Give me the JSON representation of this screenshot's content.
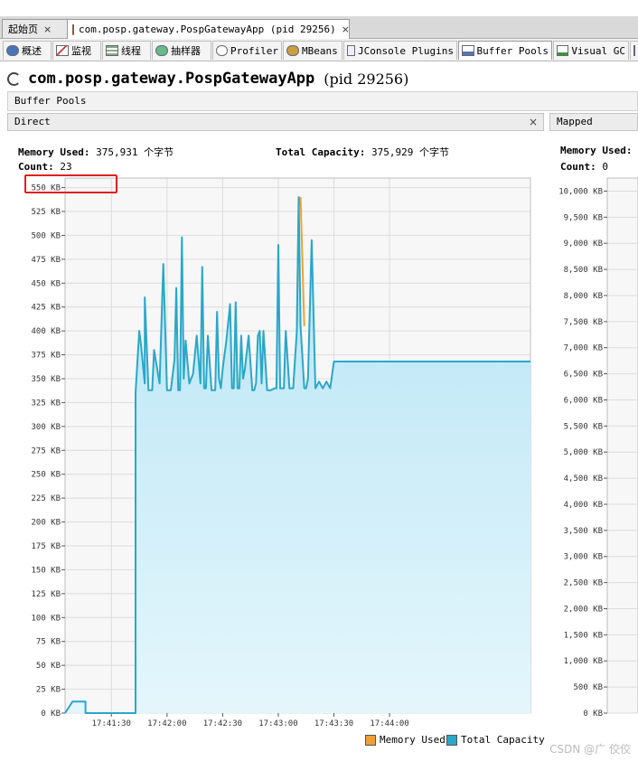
{
  "doc_tabs": [
    {
      "label": "起始页",
      "close": "×"
    },
    {
      "label": "com.posp.gateway.PospGatewayApp (pid 29256)",
      "close": "×"
    }
  ],
  "tool_tabs": [
    {
      "label": "概述",
      "icon": "info-icon"
    },
    {
      "label": "监视",
      "icon": "monitor-chart-icon"
    },
    {
      "label": "线程",
      "icon": "threads-icon"
    },
    {
      "label": "抽样器",
      "icon": "sampler-icon"
    },
    {
      "label": "Profiler",
      "icon": "profiler-clock-icon"
    },
    {
      "label": "MBeans",
      "icon": "mbeans-icon"
    },
    {
      "label": "JConsole Plugins",
      "icon": "jconsole-icon"
    },
    {
      "label": "Buffer Pools",
      "icon": "buffer-pools-icon"
    },
    {
      "label": "Visual GC",
      "icon": "visual-gc-icon"
    }
  ],
  "app": {
    "name": "com.posp.gateway.PospGatewayApp",
    "pid": "(pid 29256)"
  },
  "section_title": "Buffer Pools",
  "direct": {
    "title": "Direct",
    "close": "×",
    "memory_used_label": "Memory Used:",
    "memory_used_value": "375,931 个字节",
    "total_capacity_label": "Total Capacity:",
    "total_capacity_value": "375,929 个字节",
    "count_label": "Count:",
    "count_value": "23"
  },
  "mapped": {
    "title": "Mapped",
    "memory_used_label": "Memory Used:",
    "count_label": "Count:",
    "count_value": "0"
  },
  "legend": {
    "memory_used": "Memory Used",
    "total_capacity": "Total Capacity"
  },
  "colors": {
    "memory_used": "#f0a030",
    "total_capacity": "#2aa7c9",
    "fill": "#c8ecf8",
    "highlight": "#e02020"
  },
  "watermark": "CSDN @广 佼佼",
  "chart_data": [
    {
      "type": "area",
      "title": "Direct",
      "y_tick_labels": [
        "0 KB",
        "25 KB",
        "50 KB",
        "75 KB",
        "100 KB",
        "125 KB",
        "150 KB",
        "175 KB",
        "200 KB",
        "225 KB",
        "250 KB",
        "275 KB",
        "300 KB",
        "325 KB",
        "350 KB",
        "375 KB",
        "400 KB",
        "425 KB",
        "450 KB",
        "475 KB",
        "500 KB",
        "525 KB",
        "550 KB"
      ],
      "x_tick_labels": [
        "17:41:30",
        "17:42:00",
        "17:42:30",
        "17:43:00",
        "17:43:30",
        "17:44:00"
      ],
      "x_unit": "seconds after 17:41:00",
      "ylim": [
        0,
        560
      ],
      "xlim": [
        5,
        256
      ],
      "series": [
        {
          "name": "Total Capacity",
          "x": [
            5,
            9,
            16,
            16,
            43,
            43,
            45,
            46,
            48,
            48,
            50,
            51,
            52,
            53,
            56,
            58,
            60,
            62,
            64,
            65,
            66,
            67,
            68,
            69,
            70,
            72,
            74,
            76,
            78,
            79,
            80,
            81,
            82,
            84,
            86,
            87,
            88,
            89,
            90,
            92,
            94,
            95,
            96,
            97,
            98,
            99,
            100,
            101,
            102,
            104,
            106,
            107,
            108,
            109,
            110,
            111,
            112,
            114,
            116,
            118,
            119,
            120,
            121,
            122,
            123,
            124,
            126,
            127,
            128,
            130,
            131,
            132,
            134,
            135,
            136,
            138,
            140,
            142,
            144,
            146,
            148,
            150,
            156,
            256
          ],
          "y": [
            0,
            12,
            12,
            0,
            0,
            335,
            400,
            385,
            345,
            435,
            338,
            338,
            338,
            380,
            345,
            470,
            338,
            338,
            370,
            445,
            338,
            338,
            498,
            350,
            390,
            345,
            355,
            395,
            345,
            467,
            340,
            340,
            395,
            338,
            338,
            420,
            350,
            340,
            360,
            390,
            428,
            340,
            340,
            430,
            340,
            340,
            395,
            350,
            360,
            395,
            338,
            338,
            345,
            395,
            400,
            345,
            400,
            338,
            338,
            340,
            340,
            490,
            340,
            340,
            340,
            400,
            340,
            340,
            340,
            400,
            540,
            405,
            340,
            340,
            350,
            495,
            340,
            347,
            340,
            347,
            340,
            368,
            368,
            368
          ]
        },
        {
          "name": "Memory Used",
          "x": [
            130,
            131,
            132,
            134
          ],
          "y": [
            400,
            530,
            540,
            405
          ]
        }
      ]
    },
    {
      "type": "area",
      "title": "Mapped",
      "y_tick_labels": [
        "0 KB",
        "500 KB",
        "1,000 KB",
        "1,500 KB",
        "2,000 KB",
        "2,500 KB",
        "3,000 KB",
        "3,500 KB",
        "4,000 KB",
        "4,500 KB",
        "5,000 KB",
        "5,500 KB",
        "6,000 KB",
        "6,500 KB",
        "7,000 KB",
        "7,500 KB",
        "8,000 KB",
        "8,500 KB",
        "9,000 KB",
        "9,500 KB",
        "10,000 KB"
      ],
      "ylim": [
        0,
        10250
      ],
      "series": []
    }
  ]
}
